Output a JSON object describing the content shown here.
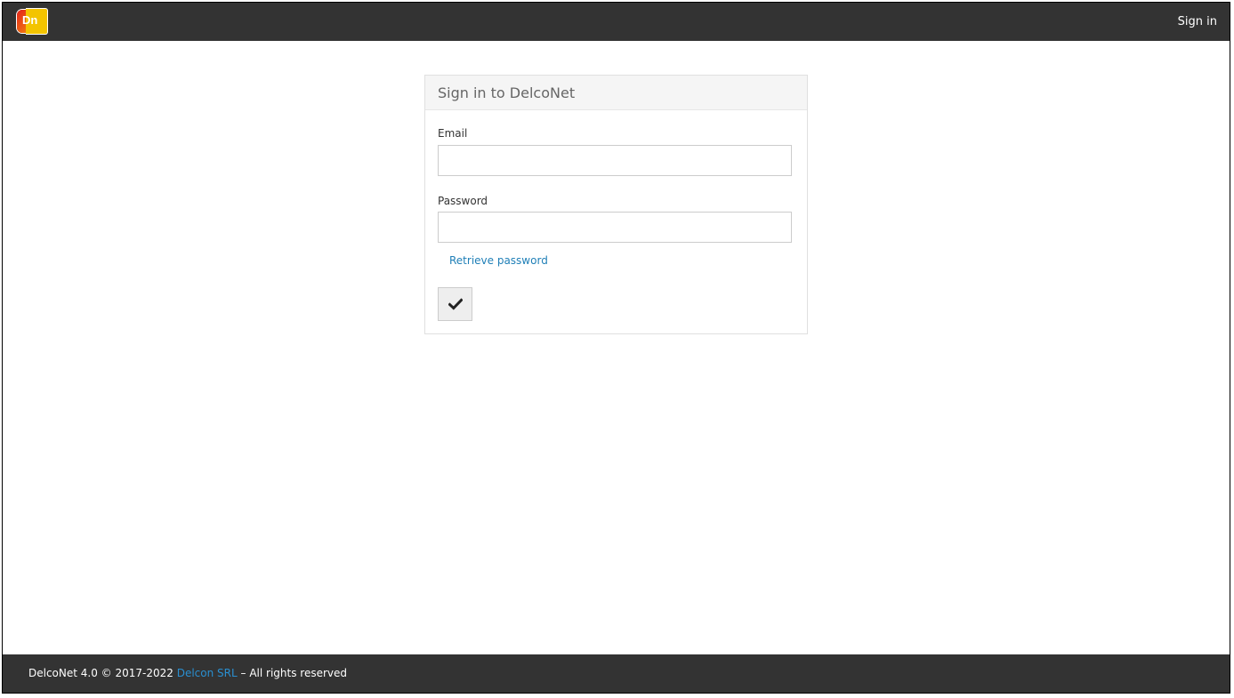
{
  "header": {
    "logo_text": "Dn",
    "signin_label": "Sign in"
  },
  "login": {
    "title": "Sign in to DelcoNet",
    "email_label": "Email",
    "email_value": "",
    "password_label": "Password",
    "password_value": "",
    "retrieve_label": "Retrieve password",
    "submit_icon": "checkmark-icon"
  },
  "footer": {
    "prefix": "DelcoNet 4.0 © 2017-2022 ",
    "company_link": "Delcon SRL",
    "suffix": " – All rights reserved"
  },
  "colors": {
    "bar_background": "#333333",
    "link": "#1f7fb7",
    "footer_link": "#2a8fd0"
  }
}
